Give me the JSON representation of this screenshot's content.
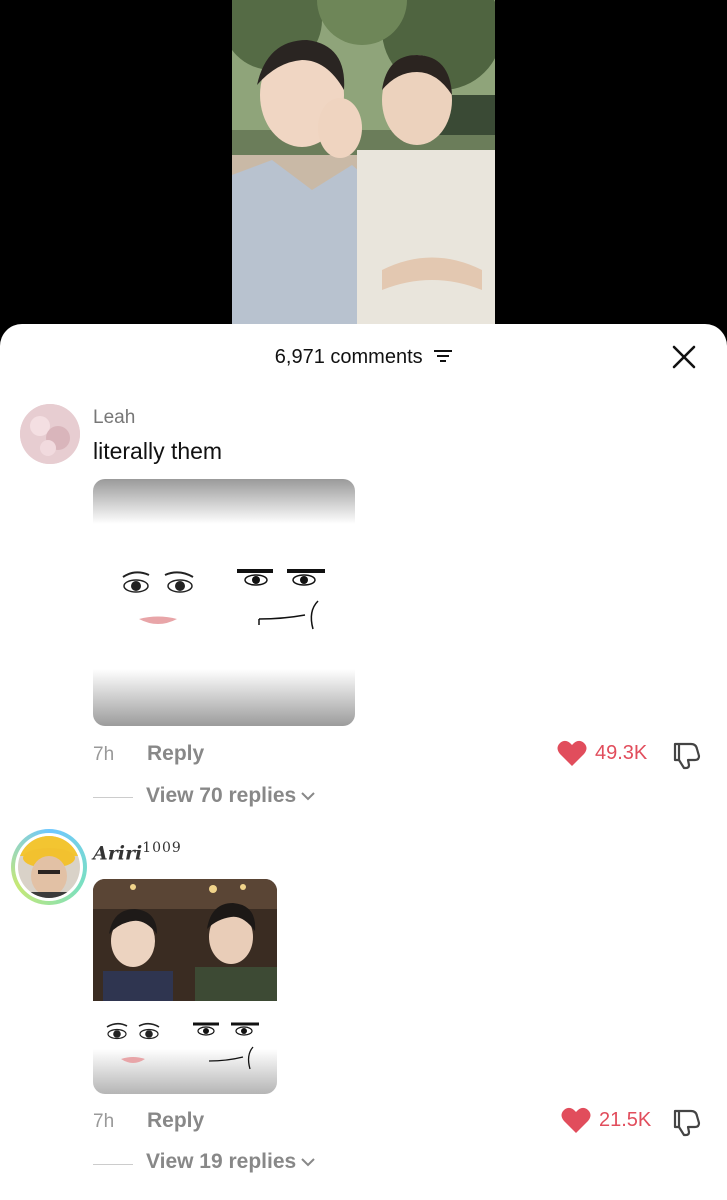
{
  "header": {
    "comment_count": "6,971 comments"
  },
  "comments": [
    {
      "username": "Leah",
      "text": "literally them",
      "time": "7h",
      "reply_label": "Reply",
      "likes": "49.3K",
      "view_replies": "View 70 replies"
    },
    {
      "username": "Ariri",
      "username_sup": "1009",
      "time": "7h",
      "reply_label": "Reply",
      "likes": "21.5K",
      "view_replies": "View 19 replies"
    }
  ],
  "colors": {
    "like": "#e14d5c",
    "text_secondary": "#888888",
    "background": "#ffffff"
  },
  "icons": [
    "filter-icon",
    "close-icon",
    "heart-icon",
    "dislike-icon",
    "chevron-down-icon"
  ]
}
